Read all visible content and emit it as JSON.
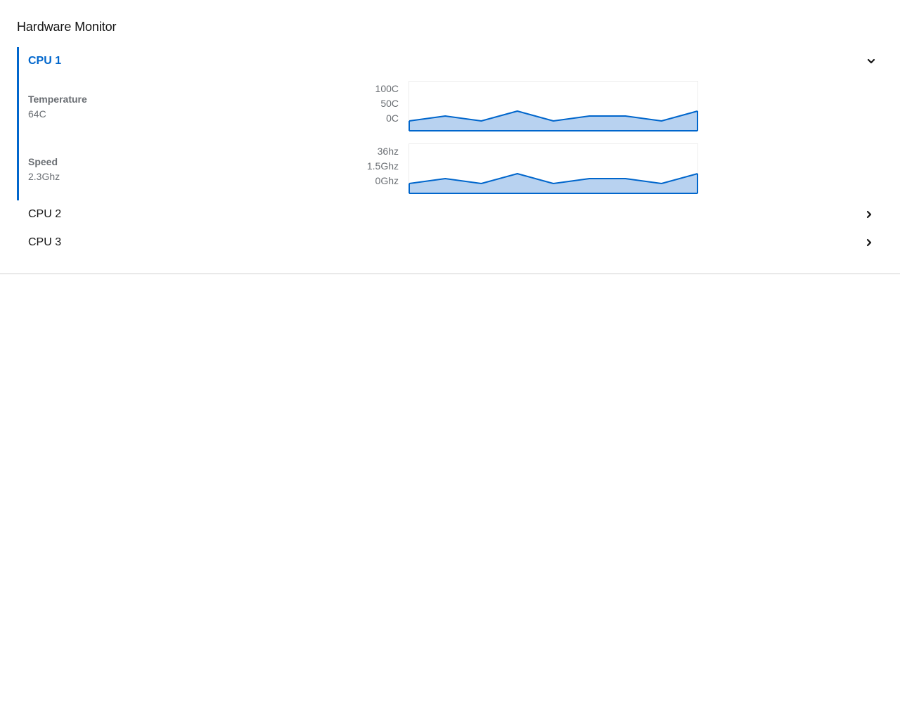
{
  "card": {
    "title": "Hardware Monitor"
  },
  "accordion": {
    "items": [
      {
        "label": "CPU 1",
        "expanded": true,
        "toggle_icon": "chevron-down-icon",
        "metrics": [
          {
            "label": "Temperature",
            "value": "64C",
            "axis_ticks": [
              "100C",
              "50C",
              "0C"
            ]
          },
          {
            "label": "Speed",
            "value": "2.3Ghz",
            "axis_ticks": [
              "36hz",
              "1.5Ghz",
              "0Ghz"
            ]
          }
        ]
      },
      {
        "label": "CPU 2",
        "expanded": false,
        "toggle_icon": "chevron-right-icon"
      },
      {
        "label": "CPU 3",
        "expanded": false,
        "toggle_icon": "chevron-right-icon"
      }
    ]
  },
  "colors": {
    "accent": "#0066cc",
    "area_fill": "#b8d2f0",
    "muted_text": "#6a6e73",
    "divider": "#d2d2d2"
  },
  "chart_data": [
    {
      "type": "area",
      "x": [
        1,
        2,
        3,
        4,
        5,
        6,
        7,
        8,
        9
      ],
      "values": [
        20,
        30,
        20,
        40,
        20,
        30,
        30,
        20,
        40
      ],
      "ylim": [
        0,
        100
      ],
      "ytick_labels": [
        "100C",
        "50C",
        "0C"
      ]
    },
    {
      "type": "area",
      "x": [
        1,
        2,
        3,
        4,
        5,
        6,
        7,
        8,
        9
      ],
      "values": [
        0.9,
        1.35,
        0.9,
        1.8,
        0.9,
        1.35,
        1.35,
        0.9,
        1.8
      ],
      "ylim": [
        0,
        4.5
      ],
      "ytick_labels": [
        "36hz",
        "1.5Ghz",
        "0Ghz"
      ]
    }
  ]
}
